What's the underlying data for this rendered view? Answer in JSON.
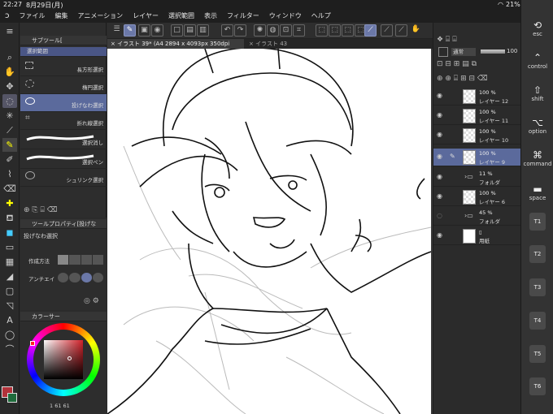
{
  "status": {
    "time": "22:27",
    "date": "8月29日(月)",
    "battery": "21%"
  },
  "menu": [
    "ファイル",
    "編集",
    "アニメーション",
    "レイヤー",
    "選択範囲",
    "表示",
    "フィルター",
    "ウィンドウ",
    "ヘルプ"
  ],
  "tabs": [
    {
      "label": "イラスト 39* (A4 2894 x 4093px 350dpi 78.8%)",
      "active": true
    },
    {
      "label": "イラスト 43",
      "active": false
    }
  ],
  "subtool": {
    "title": "サブツール[",
    "items": [
      {
        "label": "選択範囲"
      },
      {
        "label": "長方形選択"
      },
      {
        "label": "楕円選択"
      },
      {
        "label": "投げなわ選択"
      },
      {
        "label": "折れ線選択"
      },
      {
        "label": "選択消し"
      },
      {
        "label": "選択ペン"
      },
      {
        "label": "シュリンク選択"
      }
    ]
  },
  "toolprop": {
    "title": "ツールプロパティ[投げな",
    "tool_name": "投げなわ選択",
    "method_label": "作成方法",
    "antialias_label": "アンチエイ"
  },
  "color": {
    "title": "カラーサー",
    "main": "#b2323a",
    "sub": "#1f6b3c",
    "readout": "1  61  61"
  },
  "layers": {
    "blend": "通常",
    "opacity": "100",
    "items": [
      {
        "op": "100 %",
        "name": "レイヤー 12",
        "sel": false
      },
      {
        "op": "100 %",
        "name": "レイヤー 11",
        "sel": false
      },
      {
        "op": "100 %",
        "name": "レイヤー 10",
        "sel": false
      },
      {
        "op": "100 %",
        "name": "レイヤー 9",
        "sel": true
      },
      {
        "op": "11 %",
        "name": "フォルダ",
        "sel": false
      },
      {
        "op": "100 %",
        "name": "レイヤー 6",
        "sel": false
      },
      {
        "op": "45 %",
        "name": "フォルダ",
        "sel": false
      },
      {
        "op": "",
        "name": "用紙",
        "sel": false
      }
    ]
  },
  "keys": {
    "esc": "esc",
    "control": "control",
    "shift": "shift",
    "option": "option",
    "command": "command",
    "space": "space",
    "t": [
      "T1",
      "T2",
      "T3",
      "T4",
      "T5",
      "T6"
    ]
  },
  "colors": {
    "accent": "#5b6a9c",
    "panel": "#2d2d2d"
  }
}
